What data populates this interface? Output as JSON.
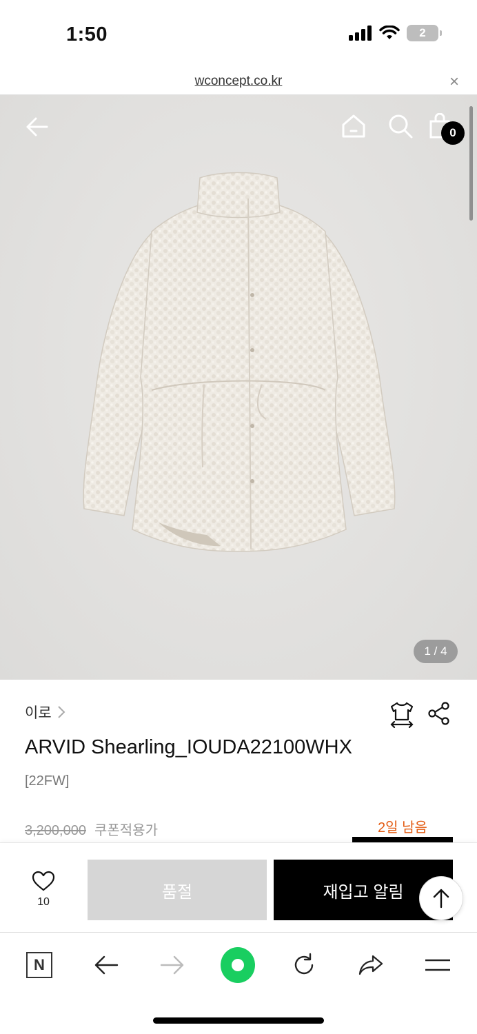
{
  "status": {
    "time": "1:50",
    "battery": "2"
  },
  "browser": {
    "url": "wconcept.co.kr",
    "close": "×"
  },
  "hero": {
    "cart_count": "0",
    "page_indicator": "1 / 4"
  },
  "product": {
    "brand": "이로",
    "title": "ARVID Shearling_IOUDA22100WHX",
    "season": "[22FW]",
    "original_price": "3,200,000",
    "coupon_label": "쿠폰적용가",
    "days_left": "2일 남음"
  },
  "actions": {
    "like_count": "10",
    "soldout_label": "품절",
    "restock_label": "재입고 알림"
  },
  "icons": [
    "back-arrow-icon",
    "home-icon",
    "search-icon",
    "bag-icon",
    "size-guide-icon",
    "share-icon",
    "heart-icon",
    "arrow-up-icon",
    "naver-icon",
    "forward-icon",
    "reload-icon",
    "menu-icon"
  ],
  "colors": {
    "accent_orange": "#e35b12",
    "green": "#19ce60",
    "soldout_gray": "#d6d6d6"
  }
}
